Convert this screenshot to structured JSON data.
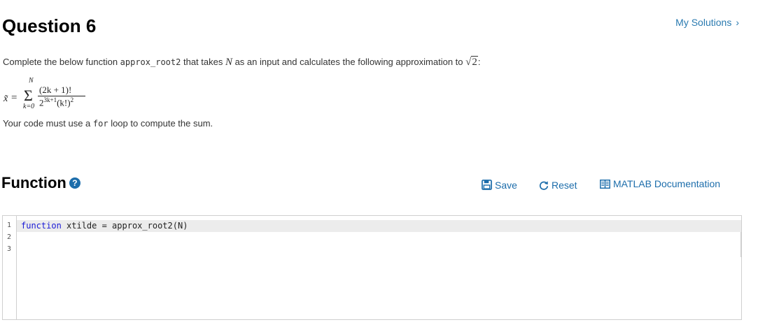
{
  "question": {
    "title": "Question 6",
    "my_solutions": "My Solutions",
    "my_solutions_chevron": "›"
  },
  "description": {
    "prefix": "Complete the below function ",
    "function_name": "approx_root2",
    "middle1": " that takes ",
    "var_N": "N",
    "middle2": " as an input and calculates the following approximation to ",
    "sqrt_sign": "√",
    "sqrt_arg": "2",
    "suffix": ":"
  },
  "formula": {
    "upper_limit": "N",
    "lhs": "x̃",
    "equals": "=",
    "sigma": "Σ",
    "numerator": "(2k + 1)!",
    "denominator_base": "2",
    "denominator_exp": "3k+1",
    "denominator_rest": "(k!)",
    "denominator_rest_exp": "2",
    "lower_limit": "k=0"
  },
  "note": {
    "prefix": "Your code must use a ",
    "keyword": "for",
    "suffix": " loop to compute the sum."
  },
  "function_section": {
    "title": "Function",
    "help_icon": "?"
  },
  "toolbar": {
    "save_label": "Save",
    "reset_label": "Reset",
    "docs_label": "MATLAB Documentation"
  },
  "editor": {
    "line_numbers": [
      "1",
      "2",
      "3"
    ],
    "line1_keyword": "function",
    "line1_rest": " xtilde = approx_root2(N)"
  },
  "colors": {
    "link": "#1c6dab",
    "keyword": "#1a1ad6",
    "line_highlight": "#ececec"
  },
  "icons": {
    "save": "floppy-disk-icon",
    "reset": "circular-arrow-icon",
    "docs": "book-icon",
    "help": "question-circle-icon",
    "chevron": "chevron-right-icon"
  }
}
